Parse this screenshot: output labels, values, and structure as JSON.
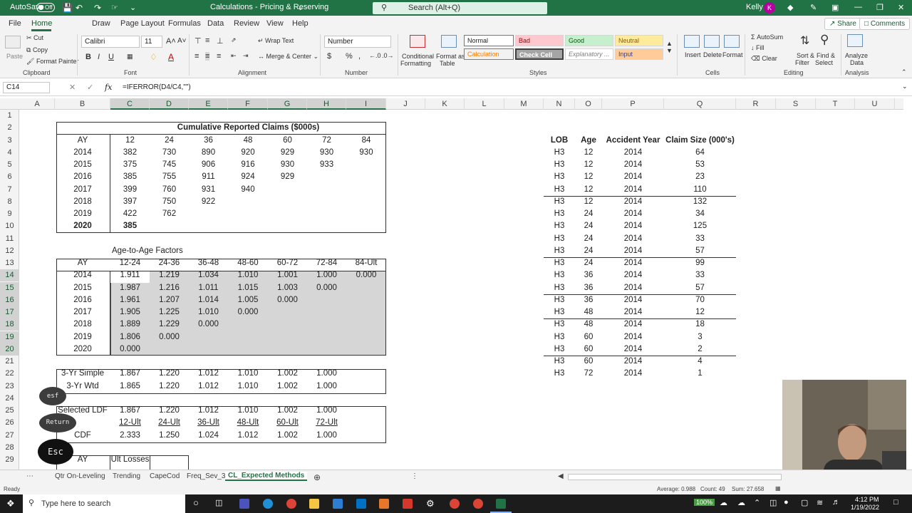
{
  "titlebar": {
    "autosave": "AutoSave",
    "autosave_state": "Off",
    "title": "Calculations - Pricing & Reserving",
    "search": "Search (Alt+Q)",
    "user": "Kelly",
    "user_initial": "K"
  },
  "menu": {
    "tabs": [
      "File",
      "Home",
      "Draw",
      "Page Layout",
      "Formulas",
      "Data",
      "Review",
      "View",
      "Help"
    ],
    "share": "Share",
    "comments": "Comments"
  },
  "ribbon": {
    "paste": "Paste",
    "cut": "Cut",
    "copy": "Copy",
    "format_painter": "Format Painter",
    "clipboard": "Clipboard",
    "font_name": "Calibri",
    "font_size": "11",
    "font": "Font",
    "wrap_text": "Wrap Text",
    "merge_center": "Merge & Center",
    "alignment": "Alignment",
    "number_format": "Number",
    "number": "Number",
    "conditional": "Conditional",
    "formatting": "Formatting",
    "format_as": "Format as",
    "table": "Table",
    "styles": "Styles",
    "style_normal": "Normal",
    "style_bad": "Bad",
    "style_good": "Good",
    "style_neutral": "Neutral",
    "style_calculation": "Calculation",
    "style_check": "Check Cell",
    "style_explanatory": "Explanatory ...",
    "style_input": "Input",
    "insert": "Insert",
    "delete": "Delete",
    "format": "Format",
    "cells": "Cells",
    "autosum": "AutoSum",
    "fill": "Fill",
    "clear": "Clear",
    "sort_filter": "Sort &",
    "sort_filter2": "Filter",
    "find_select": "Find &",
    "find_select2": "Select",
    "editing": "Editing",
    "analyze": "Analyze",
    "analyze2": "Data",
    "analysis": "Analysis"
  },
  "formula_bar": {
    "name_box": "C14",
    "formula": "=IFERROR(D4/C4,\"\")",
    "fx": "fx"
  },
  "columns": [
    "A",
    "B",
    "C",
    "D",
    "E",
    "F",
    "G",
    "H",
    "I",
    "J",
    "K",
    "L",
    "M",
    "N",
    "O",
    "P",
    "Q",
    "R",
    "S",
    "T",
    "U"
  ],
  "rows": [
    "1",
    "2",
    "3",
    "4",
    "5",
    "6",
    "7",
    "8",
    "9",
    "10",
    "11",
    "12",
    "13",
    "14",
    "15",
    "16",
    "17",
    "18",
    "19",
    "20",
    "21",
    "22",
    "23",
    "24",
    "25",
    "26",
    "27",
    "28",
    "29"
  ],
  "triangle": {
    "title": "Cumulative Reported Claims ($000s)",
    "ay_label": "AY",
    "ages": [
      "12",
      "24",
      "36",
      "48",
      "60",
      "72",
      "84"
    ],
    "rows": [
      [
        "2014",
        "382",
        "730",
        "890",
        "920",
        "929",
        "930",
        "930"
      ],
      [
        "2015",
        "375",
        "745",
        "906",
        "916",
        "930",
        "933"
      ],
      [
        "2016",
        "385",
        "755",
        "911",
        "924",
        "929"
      ],
      [
        "2017",
        "399",
        "760",
        "931",
        "940"
      ],
      [
        "2018",
        "397",
        "750",
        "922"
      ],
      [
        "2019",
        "422",
        "762"
      ],
      [
        "2020",
        "385"
      ]
    ]
  },
  "ata": {
    "title": "Age-to-Age Factors",
    "ay_label": "AY",
    "ages": [
      "12-24",
      "24-36",
      "36-48",
      "48-60",
      "60-72",
      "72-84",
      "84-Ult"
    ],
    "rows": [
      [
        "2014",
        "1.911",
        "1.219",
        "1.034",
        "1.010",
        "1.001",
        "1.000",
        "0.000"
      ],
      [
        "2015",
        "1.987",
        "1.216",
        "1.011",
        "1.015",
        "1.003",
        "0.000"
      ],
      [
        "2016",
        "1.961",
        "1.207",
        "1.014",
        "1.005",
        "0.000"
      ],
      [
        "2017",
        "1.905",
        "1.225",
        "1.010",
        "0.000"
      ],
      [
        "2018",
        "1.889",
        "1.229",
        "0.000"
      ],
      [
        "2019",
        "1.806",
        "0.000"
      ],
      [
        "2020",
        "0.000"
      ]
    ]
  },
  "averages": {
    "rows": [
      [
        "3-Yr Simple",
        "1.867",
        "1.220",
        "1.012",
        "1.010",
        "1.002",
        "1.000"
      ],
      [
        "3-Yr Wtd",
        "1.865",
        "1.220",
        "1.012",
        "1.010",
        "1.002",
        "1.000"
      ]
    ]
  },
  "ldf": {
    "selected_label": "Selected LDF",
    "selected": [
      "1.867",
      "1.220",
      "1.012",
      "1.010",
      "1.002",
      "1.000"
    ],
    "ult_labels": [
      "12-Ult",
      "24-Ult",
      "36-Ult",
      "48-Ult",
      "60-Ult",
      "72-Ult"
    ],
    "cdf_label": "CDF",
    "cdf": [
      "2.333",
      "1.250",
      "1.024",
      "1.012",
      "1.002",
      "1.000"
    ]
  },
  "ult_table": {
    "ay": "AY",
    "ult": "Ult Losses"
  },
  "claims": {
    "headers": [
      "LOB",
      "Age",
      "Accident Year",
      "Claim Size (000's)"
    ],
    "rows": [
      [
        "H3",
        "12",
        "2014",
        "64"
      ],
      [
        "H3",
        "12",
        "2014",
        "53"
      ],
      [
        "H3",
        "12",
        "2014",
        "23"
      ],
      [
        "H3",
        "12",
        "2014",
        "110"
      ],
      [
        "H3",
        "12",
        "2014",
        "132"
      ],
      [
        "H3",
        "24",
        "2014",
        "34"
      ],
      [
        "H3",
        "24",
        "2014",
        "125"
      ],
      [
        "H3",
        "24",
        "2014",
        "33"
      ],
      [
        "H3",
        "24",
        "2014",
        "57"
      ],
      [
        "H3",
        "24",
        "2014",
        "99"
      ],
      [
        "H3",
        "36",
        "2014",
        "33"
      ],
      [
        "H3",
        "36",
        "2014",
        "57"
      ],
      [
        "H3",
        "36",
        "2014",
        "70"
      ],
      [
        "H3",
        "48",
        "2014",
        "12"
      ],
      [
        "H3",
        "48",
        "2014",
        "18"
      ],
      [
        "H3",
        "60",
        "2014",
        "3"
      ],
      [
        "H3",
        "60",
        "2014",
        "2"
      ],
      [
        "H3",
        "60",
        "2014",
        "4"
      ],
      [
        "H3",
        "72",
        "2014",
        "1"
      ]
    ]
  },
  "keys": {
    "esf": "esf",
    "return": "Return",
    "esc": "Esc"
  },
  "sheets": [
    "Qtr On-Leveling",
    "Trending",
    "CapeCod",
    "Freq_Sev_3",
    "CL_Expected Methods"
  ],
  "status": {
    "ready": "Ready",
    "average": "Average: 0.988",
    "count": "Count: 49",
    "sum": "Sum: 27.658"
  },
  "taskbar": {
    "search": "Type here to search",
    "battery": "100%",
    "time": "4:12 PM",
    "date": "1/19/2022"
  },
  "colors": {
    "excel_green": "#217346"
  }
}
